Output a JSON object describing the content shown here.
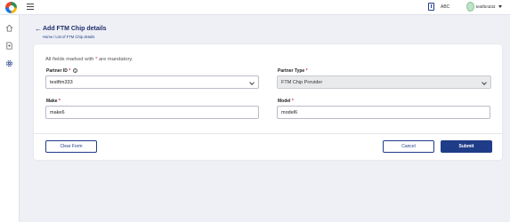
{
  "header": {
    "language": "ABC",
    "username": "testftm333"
  },
  "page": {
    "title": "Add FTM Chip details",
    "breadcrumb": [
      "Home",
      "List of FTM Chip details"
    ]
  },
  "form": {
    "mandatory_note_pre": "All fields marked with ",
    "mandatory_note_star": "*",
    "mandatory_note_post": " are mandatory.",
    "partner_id": {
      "label": "Partner ID",
      "value": "testftm333"
    },
    "partner_type": {
      "label": "Partner Type",
      "value": "FTM Chip Provider"
    },
    "make": {
      "label": "Make",
      "value": "make6"
    },
    "model": {
      "label": "Model",
      "value": "model6"
    },
    "required_marker": "*"
  },
  "actions": {
    "clear_label": "Clear Form",
    "cancel_label": "Cancel",
    "submit_label": "Submit"
  },
  "colors": {
    "primary": "#1f3c88",
    "required": "#d32f2f"
  }
}
